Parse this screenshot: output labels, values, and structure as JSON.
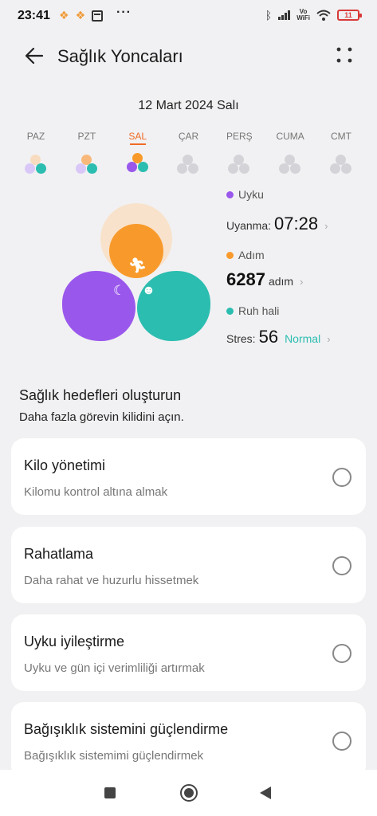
{
  "status_bar": {
    "time": "23:41",
    "battery": "11",
    "vowifi_top": "Vo",
    "vowifi_bottom": "WiFi"
  },
  "header": {
    "title": "Sağlık Yoncaları"
  },
  "date": "12 Mart 2024 Salı",
  "days": [
    {
      "label": "PAZ",
      "active": false
    },
    {
      "label": "PZT",
      "active": false
    },
    {
      "label": "SAL",
      "active": true
    },
    {
      "label": "ÇAR",
      "active": false
    },
    {
      "label": "PERŞ",
      "active": false
    },
    {
      "label": "CUMA",
      "active": false
    },
    {
      "label": "CMT",
      "active": false
    }
  ],
  "metrics": {
    "sleep": {
      "label": "Uyku",
      "key": "Uyanma:",
      "value": "07:28",
      "color": "#9a57ec"
    },
    "steps": {
      "label": "Adım",
      "value": "6287",
      "unit": "adım",
      "color": "#f89a2b"
    },
    "mood": {
      "label": "Ruh hali",
      "key": "Stres:",
      "value": "56",
      "status": "Normal",
      "color": "#2bbdb0"
    }
  },
  "goals": {
    "title": "Sağlık hedefleri oluşturun",
    "subtitle": "Daha fazla görevin kilidini açın.",
    "items": [
      {
        "title": "Kilo yönetimi",
        "desc": "Kilomu kontrol altına almak"
      },
      {
        "title": "Rahatlama",
        "desc": "Daha rahat ve huzurlu hissetmek"
      },
      {
        "title": "Uyku iyileştirme",
        "desc": "Uyku ve gün içi verimliliği artırmak"
      },
      {
        "title": "Bağışıklık sistemini güçlendirme",
        "desc": "Bağışıklık sistemimi güçlendirmek"
      }
    ]
  },
  "colors": {
    "accent": "#f06b26",
    "sleep": "#9a57ec",
    "steps": "#f89a2b",
    "mood": "#2bbdb0"
  }
}
